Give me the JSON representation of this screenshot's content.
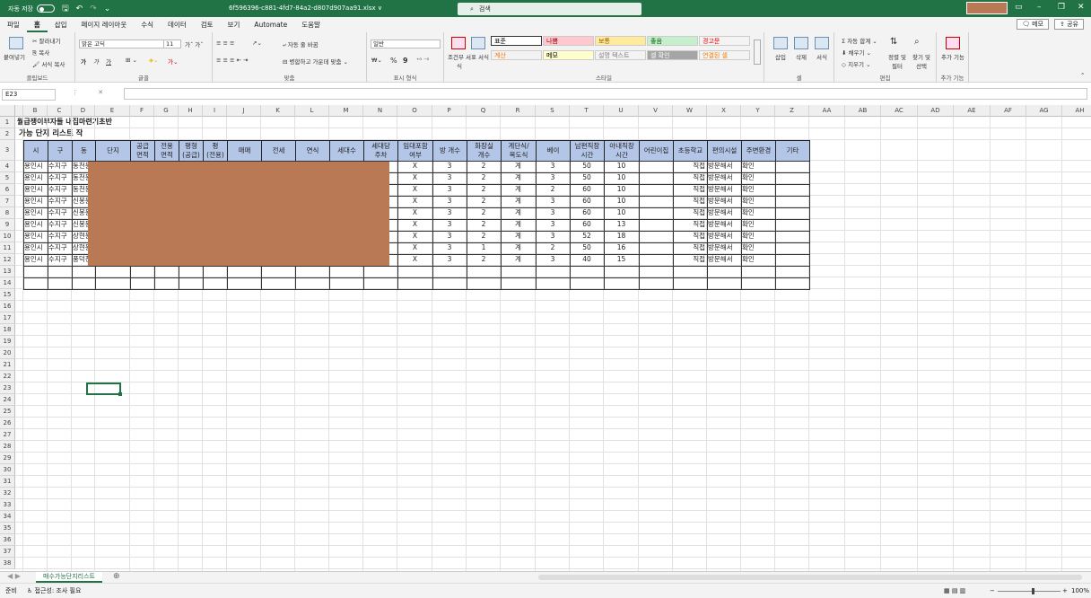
{
  "titlebar": {
    "autosave_label": "자동 저장",
    "filename": "6f596396-c881-4fd7-84a2-d807d907aa91.xlsx ∨",
    "search_placeholder": "검색",
    "user_color": "#b87954"
  },
  "menu": {
    "tabs": [
      "파일",
      "홈",
      "삽입",
      "페이지 레이아웃",
      "수식",
      "데이터",
      "검토",
      "보기",
      "Automate",
      "도움말"
    ],
    "memo": "메모",
    "share": "공유"
  },
  "ribbon": {
    "clipboard": {
      "paste": "붙여넣기",
      "cut": "잘라내기",
      "copy": "복사",
      "format_painter": "서식 복사",
      "label": "클립보드"
    },
    "font": {
      "name": "맑은 고딕",
      "size": "11",
      "label": "글꼴",
      "bold": "가",
      "italic": "가",
      "underline": "가"
    },
    "align": {
      "wrap": "자동 줄 바꿈",
      "merge": "병합하고 가운데 맞춤",
      "label": "맞춤"
    },
    "number": {
      "format": "일반",
      "label": "표시 형식",
      "percent": "%",
      "comma": "9"
    },
    "styles": {
      "cond": "조건부 서식",
      "table": "표 서식",
      "label": "스타일",
      "cells": [
        {
          "text": "표준",
          "bg": "#ffffff",
          "fg": "#000000"
        },
        {
          "text": "나쁨",
          "bg": "#ffc7ce",
          "fg": "#9c0006"
        },
        {
          "text": "보통",
          "bg": "#ffeb9c",
          "fg": "#9c5700"
        },
        {
          "text": "좋음",
          "bg": "#c6efce",
          "fg": "#006100"
        },
        {
          "text": "경고문",
          "bg": "#f3f3f3",
          "fg": "#ff0000"
        },
        {
          "text": "계산",
          "bg": "#f2f2f2",
          "fg": "#fa7d00"
        },
        {
          "text": "메모",
          "bg": "#ffffcc",
          "fg": "#000000"
        },
        {
          "text": "설명 텍스트",
          "bg": "#f3f3f3",
          "fg": "#7f7f7f"
        },
        {
          "text": "셀 확인",
          "bg": "#a5a5a5",
          "fg": "#ffffff"
        },
        {
          "text": "연결된 셀",
          "bg": "#f3f3f3",
          "fg": "#fa7d00"
        }
      ]
    },
    "cells": {
      "insert": "삽입",
      "delete": "삭제",
      "format": "서식",
      "label": "셀"
    },
    "edit": {
      "autosum": "자동 합계",
      "fill": "채우기",
      "clear": "지우기",
      "sort": "정렬 및 필터",
      "find": "찾기 및 선택",
      "label": "편집"
    },
    "addins": {
      "btn": "추가 기능",
      "label": "추가 기능"
    }
  },
  "formula": {
    "namebox": "E23",
    "fx": "fx"
  },
  "columns": [
    "A",
    "B",
    "C",
    "D",
    "E",
    "F",
    "G",
    "H",
    "I",
    "J",
    "K",
    "L",
    "M",
    "N",
    "O",
    "P",
    "Q",
    "R",
    "S",
    "T",
    "U",
    "V",
    "W",
    "X",
    "Y",
    "Z",
    "AA",
    "AB",
    "AC",
    "AD",
    "AE",
    "AF",
    "AG",
    "AH"
  ],
  "rows": [
    "1",
    "2",
    "3",
    "4",
    "5",
    "6",
    "7",
    "8",
    "9",
    "10",
    "11",
    "12",
    "13",
    "14",
    "15",
    "16",
    "17",
    "18",
    "19",
    "20",
    "21",
    "22",
    "23",
    "24",
    "25",
    "26",
    "27",
    "28",
    "29",
    "30",
    "31",
    "32",
    "33",
    "34",
    "35",
    "36",
    "37",
    "38"
  ],
  "sheet": {
    "title1": "월급쟁이부자들 내집마련기초반",
    "title2": "가능 단지 리스트 작",
    "headers": [
      "시",
      "구",
      "동",
      "단지",
      "공급\n면적",
      "전용\n면적",
      "평형\n(공급)",
      "평\n(전용)",
      "매매",
      "전세",
      "연식",
      "세대수",
      "세대당\n주차",
      "임대포함\n여부",
      "방 개수",
      "화장실\n개수",
      "계단식/\n복도식",
      "베이",
      "남편직장\n시간",
      "아내직장\n시간",
      "어린이집",
      "초등학교",
      "편의시설",
      "주변환경",
      "기타"
    ],
    "data": [
      {
        "si": "용인시",
        "gu": "수지구",
        "dong": "동천동",
        "rent": "X",
        "rooms": "3",
        "bath": "2",
        "stair": "계",
        "bay": "3",
        "h": "50",
        "w": "10",
        "sch": "직접",
        "conv": "방문해서",
        "env": "확인"
      },
      {
        "si": "용인시",
        "gu": "수지구",
        "dong": "동천동",
        "rent": "X",
        "rooms": "3",
        "bath": "2",
        "stair": "계",
        "bay": "3",
        "h": "50",
        "w": "10",
        "sch": "직접",
        "conv": "방문해서",
        "env": "확인"
      },
      {
        "si": "용인시",
        "gu": "수지구",
        "dong": "동천동",
        "rent": "X",
        "rooms": "3",
        "bath": "2",
        "stair": "계",
        "bay": "2",
        "h": "60",
        "w": "10",
        "sch": "직접",
        "conv": "방문해서",
        "env": "확인"
      },
      {
        "si": "용인시",
        "gu": "수지구",
        "dong": "신봉동",
        "rent": "X",
        "rooms": "3",
        "bath": "2",
        "stair": "계",
        "bay": "3",
        "h": "60",
        "w": "10",
        "sch": "직접",
        "conv": "방문해서",
        "env": "확인"
      },
      {
        "si": "용인시",
        "gu": "수지구",
        "dong": "신봉동",
        "rent": "X",
        "rooms": "3",
        "bath": "2",
        "stair": "계",
        "bay": "3",
        "h": "60",
        "w": "10",
        "sch": "직접",
        "conv": "방문해서",
        "env": "확인"
      },
      {
        "si": "용인시",
        "gu": "수지구",
        "dong": "신봉동",
        "rent": "X",
        "rooms": "3",
        "bath": "2",
        "stair": "계",
        "bay": "3",
        "h": "60",
        "w": "13",
        "sch": "직접",
        "conv": "방문해서",
        "env": "확인"
      },
      {
        "si": "용인시",
        "gu": "수지구",
        "dong": "상현동",
        "rent": "X",
        "rooms": "3",
        "bath": "2",
        "stair": "계",
        "bay": "3",
        "h": "52",
        "w": "18",
        "sch": "직접",
        "conv": "방문해서",
        "env": "확인"
      },
      {
        "si": "용인시",
        "gu": "수지구",
        "dong": "상현동",
        "rent": "X",
        "rooms": "3",
        "bath": "1",
        "stair": "계",
        "bay": "2",
        "h": "50",
        "w": "16",
        "sch": "직접",
        "conv": "방문해서",
        "env": "확인"
      },
      {
        "si": "용인시",
        "gu": "수지구",
        "dong": "풍덕천동",
        "rent": "X",
        "rooms": "3",
        "bath": "2",
        "stair": "계",
        "bay": "3",
        "h": "40",
        "w": "15",
        "sch": "직접",
        "conv": "방문해서",
        "env": "확인"
      }
    ],
    "redact_color": "#b87954",
    "header_color": "#b4c6e7"
  },
  "sheettab": "매수가능단지리스트",
  "status": {
    "ready": "준비",
    "accessibility": "접근성: 조사 필요",
    "zoom": "100%"
  }
}
